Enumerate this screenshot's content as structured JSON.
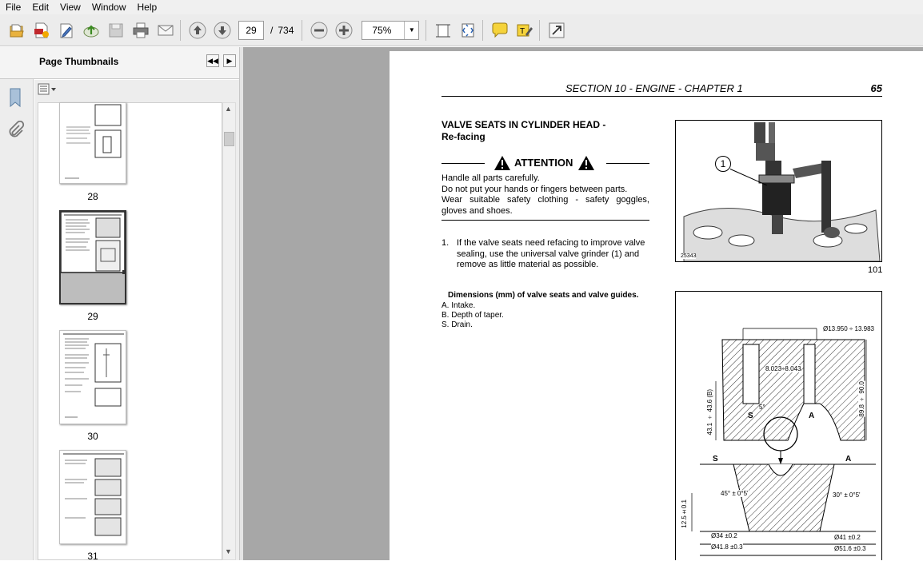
{
  "menu": {
    "items": [
      "File",
      "Edit",
      "View",
      "Window",
      "Help"
    ]
  },
  "toolbar": {
    "current_page": "29",
    "total_pages": "734",
    "page_separator": "/",
    "zoom_value": "75%",
    "icons": [
      "open-icon",
      "create-pdf-icon",
      "edit-icon",
      "upload-icon",
      "save-icon",
      "print-icon",
      "email-icon",
      "page-up-icon",
      "page-down-icon",
      "zoom-out-icon",
      "zoom-in-icon",
      "fit-page-icon",
      "fit-width-icon",
      "comment-icon",
      "highlight-icon",
      "fullscreen-icon"
    ]
  },
  "panel": {
    "title": "Page Thumbnails",
    "thumbnails": [
      {
        "label": "28"
      },
      {
        "label": "29",
        "selected": true
      },
      {
        "label": "30"
      },
      {
        "label": "31"
      }
    ]
  },
  "document": {
    "section_header": "SECTION 10 - ENGINE - CHAPTER 1",
    "page_number": "65",
    "heading_line1": "VALVE SEATS IN CYLINDER HEAD -",
    "heading_line2": "Re-facing",
    "attention_title": "ATTENTION",
    "attention_lines": [
      "Handle all parts carefully.",
      "Do not put your hands or fingers between parts.",
      "Wear suitable safety clothing - safety goggles,",
      "gloves and shoes."
    ],
    "step_number": "1.",
    "step_lines": [
      "If the valve seats need refacing to improve valve",
      "sealing, use the universal valve grinder (1) and",
      "remove as little material as possible."
    ],
    "dimensions_title": "Dimensions (mm) of valve seats and valve guides.",
    "dimension_items": [
      "A. Intake.",
      "B. Depth of taper.",
      "S. Drain."
    ],
    "figure1": {
      "callout": "1",
      "code": "25343",
      "number": "101"
    },
    "figure2": {
      "labels": {
        "diam_top": "Ø13.950 ÷ 13.983",
        "guide_bore": "8.023÷8.043",
        "height_right": "89.8 ÷ 90.0",
        "height_left": "43.1 ÷ 43.6 (B)",
        "letter_s_upper": "S",
        "letter_a_upper": "A",
        "angle_small": "5°",
        "letter_s_lower": "S",
        "letter_a_lower": "A",
        "angle_left": "45° ± 0°5'",
        "angle_right": "30° ± 0°5'",
        "height_lower": "12.5±0.1",
        "diam_34": "Ø34 ±0.2",
        "diam_41": "Ø41 ±0.2",
        "diam_418": "Ø41.8 ±0.3",
        "diam_516": "Ø51.6 ±0.3"
      }
    }
  }
}
